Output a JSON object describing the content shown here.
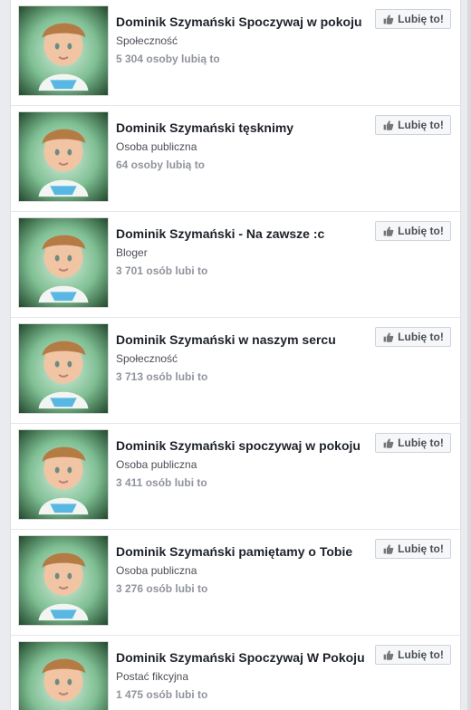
{
  "button_label": "Lubię to!",
  "pages": [
    {
      "title": "Dominik Szymański Spoczywaj w pokoju",
      "category": "Społeczność",
      "likes": "5 304 osoby lubią to"
    },
    {
      "title": "Dominik Szymański tęsknimy",
      "category": "Osoba publiczna",
      "likes": "64 osoby lubią to"
    },
    {
      "title": "Dominik Szymański - Na zawsze :c",
      "category": "Bloger",
      "likes": "3 701 osób lubi to"
    },
    {
      "title": "Dominik Szymański w naszym sercu",
      "category": "Społeczność",
      "likes": "3 713 osób lubi to"
    },
    {
      "title": "Dominik Szymański spoczywaj w pokoju",
      "category": "Osoba publiczna",
      "likes": "3 411 osób lubi to"
    },
    {
      "title": "Dominik Szymański pamiętamy o Tobie",
      "category": "Osoba publiczna",
      "likes": "3 276 osób lubi to"
    },
    {
      "title": "Dominik Szymański Spoczywaj W Pokoju",
      "category": "Postać fikcyjna",
      "likes": "1 475 osób lubi to"
    }
  ]
}
